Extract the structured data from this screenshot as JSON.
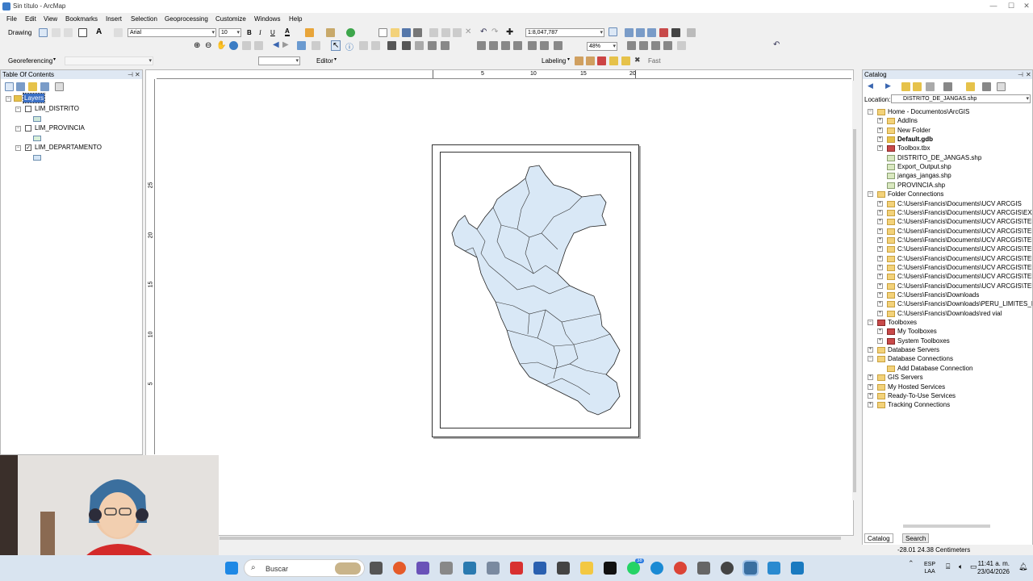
{
  "window": {
    "title": "Sin título - ArcMap",
    "minimize": "—",
    "maximize": "☐",
    "close": "✕"
  },
  "menu": [
    "File",
    "Edit",
    "View",
    "Bookmarks",
    "Insert",
    "Selection",
    "Geoprocessing",
    "Customize",
    "Windows",
    "Help"
  ],
  "toolbar": {
    "drawing_label": "Drawing",
    "font_name": "Arial",
    "font_size": "10",
    "bold": "B",
    "italic": "I",
    "underline": "U",
    "scale": "1:8,047,787",
    "zoom": "48%",
    "georeferencing_label": "Georeferencing",
    "editor_label": "Editor",
    "labeling_label": "Labeling",
    "labeling_quality": "Fast"
  },
  "toc": {
    "title": "Table Of Contents",
    "root_label": "Layers",
    "layers": [
      {
        "name": "LIM_DISTRITO",
        "checked": false,
        "swatch_color": "#cfe8da"
      },
      {
        "name": "LIM_PROVINCIA",
        "checked": false,
        "swatch_color": "#d9f0d9"
      },
      {
        "name": "LIM_DEPARTAMENTO",
        "checked": true,
        "swatch_color": "#d4e5f5"
      }
    ]
  },
  "ruler": {
    "h": [
      "5",
      "10",
      "15",
      "20"
    ],
    "v": [
      "25",
      "20",
      "15",
      "10",
      "5"
    ]
  },
  "map": {
    "fill_color": "#d9e8f6",
    "stroke_color": "#222222"
  },
  "catalog": {
    "title": "Catalog",
    "location_label": "Location:",
    "location_value": "DISTRITO_DE_JANGAS.shp",
    "tabs": [
      "Catalog",
      "Search"
    ],
    "items": [
      {
        "level": 0,
        "label": "Home - Documentos\\ArcGIS",
        "bold": false,
        "exp": "−"
      },
      {
        "level": 1,
        "label": "AddIns",
        "bold": false,
        "exp": "+"
      },
      {
        "level": 1,
        "label": "New Folder",
        "bold": false,
        "exp": "+"
      },
      {
        "level": 1,
        "label": "Default.gdb",
        "bold": true,
        "exp": "+"
      },
      {
        "level": 1,
        "label": "Toolbox.tbx",
        "bold": false,
        "exp": "+"
      },
      {
        "level": 1,
        "label": "DISTRITO_DE_JANGAS.shp",
        "bold": false,
        "exp": ""
      },
      {
        "level": 1,
        "label": "Export_Output.shp",
        "bold": false,
        "exp": ""
      },
      {
        "level": 1,
        "label": "jangas_jangas.shp",
        "bold": false,
        "exp": ""
      },
      {
        "level": 1,
        "label": "PROVINCIA.shp",
        "bold": false,
        "exp": ""
      },
      {
        "level": 0,
        "label": "Folder Connections",
        "bold": false,
        "exp": "−"
      },
      {
        "level": 1,
        "label": "C:\\Users\\Francis\\Documents\\UCV ARCGIS",
        "bold": false,
        "exp": "+"
      },
      {
        "level": 1,
        "label": "C:\\Users\\Francis\\Documents\\UCV ARCGIS\\EXA",
        "bold": false,
        "exp": "+"
      },
      {
        "level": 1,
        "label": "C:\\Users\\Francis\\Documents\\UCV ARCGIS\\TEN",
        "bold": false,
        "exp": "+"
      },
      {
        "level": 1,
        "label": "C:\\Users\\Francis\\Documents\\UCV ARCGIS\\TEN",
        "bold": false,
        "exp": "+"
      },
      {
        "level": 1,
        "label": "C:\\Users\\Francis\\Documents\\UCV ARCGIS\\TEN",
        "bold": false,
        "exp": "+"
      },
      {
        "level": 1,
        "label": "C:\\Users\\Francis\\Documents\\UCV ARCGIS\\TEN",
        "bold": false,
        "exp": "+"
      },
      {
        "level": 1,
        "label": "C:\\Users\\Francis\\Documents\\UCV ARCGIS\\TEN",
        "bold": false,
        "exp": "+"
      },
      {
        "level": 1,
        "label": "C:\\Users\\Francis\\Documents\\UCV ARCGIS\\TEN",
        "bold": false,
        "exp": "+"
      },
      {
        "level": 1,
        "label": "C:\\Users\\Francis\\Documents\\UCV ARCGIS\\TEN",
        "bold": false,
        "exp": "+"
      },
      {
        "level": 1,
        "label": "C:\\Users\\Francis\\Documents\\UCV ARCGIS\\TEN",
        "bold": false,
        "exp": "+"
      },
      {
        "level": 1,
        "label": "C:\\Users\\Francis\\Downloads",
        "bold": false,
        "exp": "+"
      },
      {
        "level": 1,
        "label": "C:\\Users\\Francis\\Downloads\\PERU_LIMITES_DP",
        "bold": false,
        "exp": "+"
      },
      {
        "level": 1,
        "label": "C:\\Users\\Francis\\Downloads\\red vial",
        "bold": false,
        "exp": "+"
      },
      {
        "level": 0,
        "label": "Toolboxes",
        "bold": false,
        "exp": "−"
      },
      {
        "level": 1,
        "label": "My Toolboxes",
        "bold": false,
        "exp": "+"
      },
      {
        "level": 1,
        "label": "System Toolboxes",
        "bold": false,
        "exp": "+"
      },
      {
        "level": 0,
        "label": "Database Servers",
        "bold": false,
        "exp": "+"
      },
      {
        "level": 0,
        "label": "Database Connections",
        "bold": false,
        "exp": "−"
      },
      {
        "level": 1,
        "label": "Add Database Connection",
        "bold": false,
        "exp": ""
      },
      {
        "level": 0,
        "label": "GIS Servers",
        "bold": false,
        "exp": "+"
      },
      {
        "level": 0,
        "label": "My Hosted Services",
        "bold": false,
        "exp": "+"
      },
      {
        "level": 0,
        "label": "Ready-To-Use Services",
        "bold": false,
        "exp": "+"
      },
      {
        "level": 0,
        "label": "Tracking Connections",
        "bold": false,
        "exp": "+"
      }
    ]
  },
  "status": {
    "coordinates": "-28.01  24.38 Centimeters"
  },
  "taskbar": {
    "search_placeholder": "Buscar",
    "lang": "ESP",
    "lang2": "LAA",
    "time": "11:41 a. m.",
    "date": "23/04/2026",
    "badge_count": "38"
  }
}
